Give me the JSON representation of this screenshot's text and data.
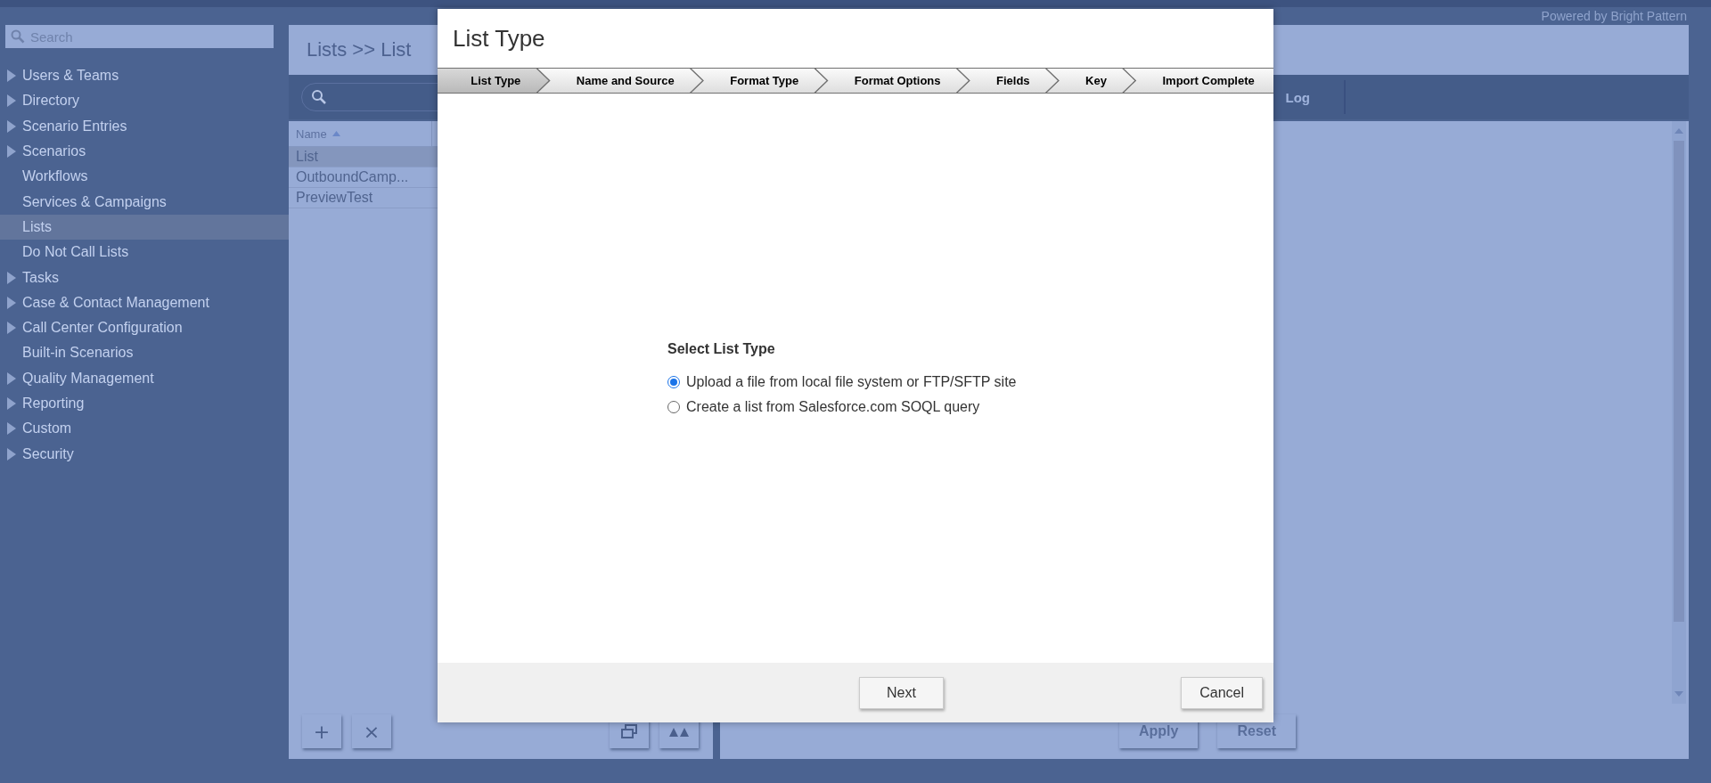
{
  "header": {
    "branding": "Powered by Bright Pattern"
  },
  "sidebar": {
    "search": {
      "placeholder": "Search"
    },
    "items": [
      {
        "label": "Users & Teams",
        "kind": "group",
        "selected": false
      },
      {
        "label": "Directory",
        "kind": "group",
        "selected": false
      },
      {
        "label": "Scenario Entries",
        "kind": "group",
        "selected": false
      },
      {
        "label": "Scenarios",
        "kind": "group",
        "selected": false
      },
      {
        "label": "Workflows",
        "kind": "item",
        "selected": false
      },
      {
        "label": "Services & Campaigns",
        "kind": "item",
        "selected": false
      },
      {
        "label": "Lists",
        "kind": "item",
        "selected": true
      },
      {
        "label": "Do Not Call Lists",
        "kind": "item",
        "selected": false
      },
      {
        "label": "Tasks",
        "kind": "group",
        "selected": false
      },
      {
        "label": "Case & Contact Management",
        "kind": "group",
        "selected": false
      },
      {
        "label": "Call Center Configuration",
        "kind": "group",
        "selected": false
      },
      {
        "label": "Built-in Scenarios",
        "kind": "item",
        "selected": false
      },
      {
        "label": "Quality Management",
        "kind": "group",
        "selected": false
      },
      {
        "label": "Reporting",
        "kind": "group",
        "selected": false
      },
      {
        "label": "Custom",
        "kind": "group",
        "selected": false
      },
      {
        "label": "Security",
        "kind": "group",
        "selected": false
      }
    ]
  },
  "main": {
    "breadcrumb": "Lists >> List",
    "tabs": [
      {
        "label": "Log"
      }
    ],
    "table": {
      "columns": [
        "Name"
      ],
      "rows": [
        {
          "name": "List",
          "selected": true
        },
        {
          "name": "OutboundCamp...",
          "selected": false
        },
        {
          "name": "PreviewTest",
          "selected": false
        }
      ]
    },
    "list_buttons": [
      "+",
      "×"
    ],
    "buttons": [
      "Apply",
      "Reset"
    ]
  },
  "dialog": {
    "title": "List Type",
    "steps": [
      {
        "label": "List Type",
        "selected": true
      },
      {
        "label": "Name and Source",
        "selected": false
      },
      {
        "label": "Format Type",
        "selected": false
      },
      {
        "label": "Format Options",
        "selected": false
      },
      {
        "label": "Fields",
        "selected": false
      },
      {
        "label": "Key",
        "selected": false
      },
      {
        "label": "Import Complete",
        "selected": false
      }
    ],
    "section_title": "Select List Type",
    "options": [
      {
        "label": "Upload a file from local file system or FTP/SFTP site",
        "selected": true
      },
      {
        "label": "Create a list from Salesforce.com SOQL query",
        "selected": false
      }
    ],
    "buttons": [
      "Next",
      "Cancel"
    ]
  }
}
